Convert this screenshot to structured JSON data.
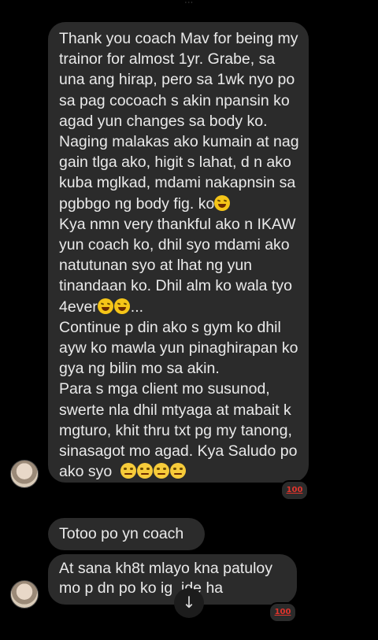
{
  "top_indicator": "ᐧᐧᐧ",
  "messages": [
    {
      "text": "Thank you coach Mav for being my trainor for almost 1yr. Grabe, sa una ang hirap, pero sa 1wk nyo po sa pag cocoach s akin npansin ko agad yun changes sa body ko. Naging malakas ako kumain at nag gain tlga ako, higit s lahat, d n ako kuba mglkad, mdami nakapnsin sa pgbbgo ng body fig. ko",
      "text2": "Kya nmn very thankful ako n IKAW yun coach ko, dhil syo mdami ako natutunan syo at lhat ng yun tinandaan ko. Dhil alm ko wala tyo 4ever",
      "text3": "...",
      "text4": "Continue p din ako s gym ko dhil ayw ko mawla yun pinaghirapan ko gya ng bilin mo sa akin.\nPara s mga client mo susunod, swerte nla dhil mtyaga at mabait k mgturo, khit thru txt pg my tanong, sinasagot mo agad. Kya Saludo po ako syo",
      "reaction": "100"
    },
    {
      "text": "Totoo po yn coach"
    },
    {
      "text": "At sana kh8t mlayo kna patuloy mo p dn po ko ig  ide ha",
      "reaction": "100"
    }
  ],
  "emoji_names": [
    "rolling-laughing-emoji",
    "saluting-face-emoji"
  ],
  "scroll_button": "↓"
}
